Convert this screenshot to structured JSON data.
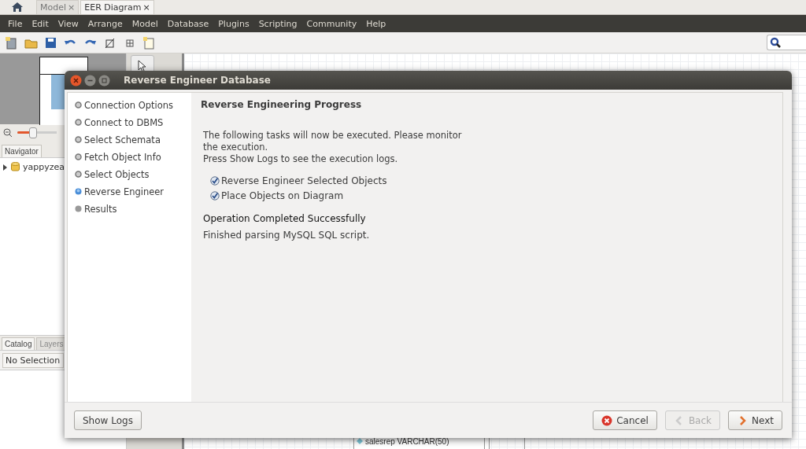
{
  "app_tabs": [
    {
      "label": "Model",
      "close": "×",
      "selected": false
    },
    {
      "label": "EER Diagram",
      "close": "×",
      "selected": true
    }
  ],
  "menu": [
    "File",
    "Edit",
    "View",
    "Arrange",
    "Model",
    "Database",
    "Plugins",
    "Scripting",
    "Community",
    "Help"
  ],
  "navigator": {
    "tab": "Navigator",
    "level": 0.4
  },
  "tree": [
    {
      "label": "yappyzea",
      "expanded": false
    }
  ],
  "sidebar_tabs": [
    {
      "label": "Catalog",
      "selected": true
    },
    {
      "label": "Layers",
      "selected": false
    }
  ],
  "selection": "No Selection",
  "canvas": {
    "entity_row": "salesrep VARCHAR(50)"
  },
  "dialog": {
    "title": "Reverse Engineer Database",
    "steps": [
      {
        "label": "Connection Options",
        "done": true,
        "selected": false
      },
      {
        "label": "Connect to DBMS",
        "done": true,
        "selected": false
      },
      {
        "label": "Select Schemata",
        "done": true,
        "selected": false
      },
      {
        "label": "Fetch Object Info",
        "done": true,
        "selected": false
      },
      {
        "label": "Select Objects",
        "done": true,
        "selected": false
      },
      {
        "label": "Reverse Engineer",
        "done": false,
        "selected": true
      },
      {
        "label": "Results",
        "done": false,
        "selected": false
      }
    ],
    "heading": "Reverse Engineering Progress",
    "intro": [
      "The following tasks will now be executed. Please monitor the execution.",
      "Press Show Logs to see the execution logs."
    ],
    "tasks": [
      {
        "label": "Reverse Engineer Selected Objects",
        "checked": true
      },
      {
        "label": "Place Objects on Diagram",
        "checked": true
      }
    ],
    "status_title": "Operation Completed Successfully",
    "status_message": "Finished parsing MySQL SQL script.",
    "left_buttons": [
      {
        "label": "Show Logs",
        "disabled": false
      }
    ],
    "right_buttons": [
      {
        "label": "Cancel",
        "kind": "cancel",
        "disabled": false
      },
      {
        "label": "Back",
        "kind": "back",
        "disabled": true
      },
      {
        "label": "Next",
        "kind": "next",
        "disabled": false
      }
    ]
  }
}
